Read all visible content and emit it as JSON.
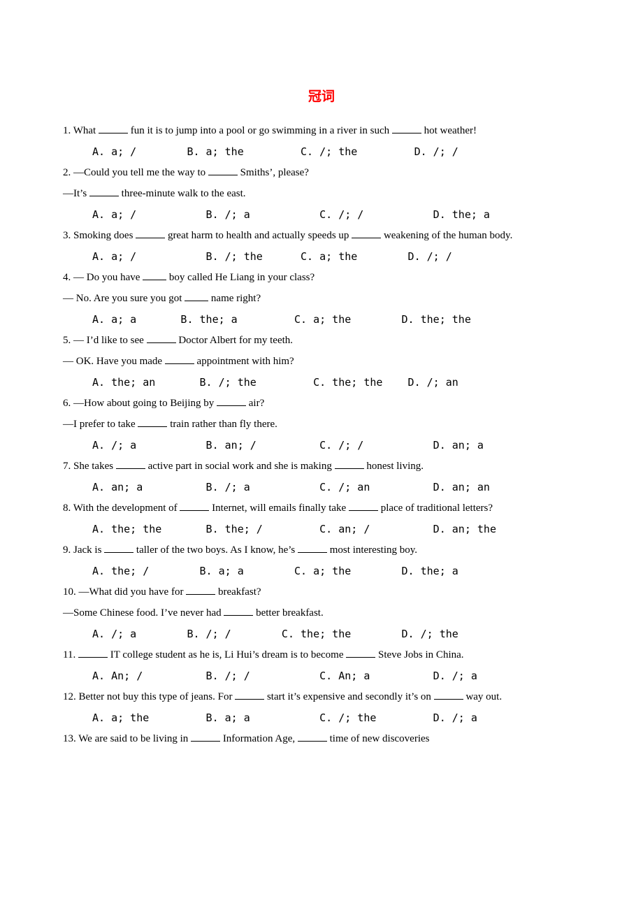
{
  "title": "冠词",
  "q1": {
    "text_a": " 1. What ",
    "text_b": " fun it is to jump into a pool or go swimming in a river in such ",
    "text_c": " hot weather!",
    "options": "A. a; /        B. a; the         C. /; the         D. /; /"
  },
  "q2": {
    "line1_a": " 2. —Could you tell me the way to ",
    "line1_b": " Smiths’, please?",
    "line2_a": "  —It’s ",
    "line2_b": " three-minute walk to the east.",
    "options": "A. a; /           B. /; a           C. /; /           D. the; a"
  },
  "q3": {
    "text_a": " 3. Smoking does ",
    "text_b": " great harm to health and actually speeds up ",
    "text_c": " weakening of the human body.",
    "options": "A. a; /           B. /; the      C. a; the        D. /; /"
  },
  "q4": {
    "line1_a": " 4. — Do you have ",
    "line1_b": " boy called He Liang in your class?",
    "line2_a": "   — No. Are you sure you got ",
    "line2_b": " name right?",
    "options": "A. a; a       B. the; a         C. a; the        D. the; the"
  },
  "q5": {
    "line1_a": " 5. — I’d like to see ",
    "line1_b": " Doctor Albert for my teeth.",
    "line2_a": "   — OK. Have you made ",
    "line2_b": " appointment with him?",
    "options": "A. the; an       B. /; the         C. the; the    D. /; an"
  },
  "q6": {
    "line1_a": " 6. —How about going to Beijing by ",
    "line1_b": " air?",
    "line2_a": "   —I prefer to take ",
    "line2_b": " train rather than fly there.",
    "options": "A. /; a           B. an; /          C. /; /           D. an; a"
  },
  "q7": {
    "text_a": " 7. She takes ",
    "text_b": " active part in social work and she is making ",
    "text_c": " honest living.",
    "options": "A. an; a          B. /; a           C. /; an          D. an; an"
  },
  "q8": {
    "text_a": " 8. With the development of ",
    "text_b": " Internet, will emails finally take ",
    "text_c": " place of traditional letters?",
    "options": "A. the; the       B. the; /         C. an; /          D. an; the"
  },
  "q9": {
    "text_a": " 9. Jack is ",
    "text_b": " taller of the two boys. As I know, he’s ",
    "text_c": " most interesting boy.",
    "options": "A. the; /        B. a; a        C. a; the        D. the; a"
  },
  "q10": {
    "line1_a": " 10. —What did you have for ",
    "line1_b": " breakfast?",
    "line2_a": "    —Some Chinese food. I’ve never had ",
    "line2_b": " better breakfast.",
    "options": "A. /; a        B. /; /        C. the; the        D. /; the"
  },
  "q11": {
    "text_a": " 11. ",
    "text_b": " IT college student as he is, Li Hui’s dream is to become ",
    "text_c": " Steve Jobs in China.",
    "options": "A. An; /          B. /; /           C. An; a          D. /; a"
  },
  "q12": {
    "text_a": " 12. Better not buy this type of jeans. For ",
    "text_b": " start it’s expensive and secondly it’s on ",
    "text_c": " way out.",
    "options": "A. a; the         B. a; a           C. /; the         D. /; a"
  },
  "q13": {
    "text_a": " 13. We are said to be living in ",
    "text_b": " Information Age, ",
    "text_c": " time of new discoveries"
  }
}
